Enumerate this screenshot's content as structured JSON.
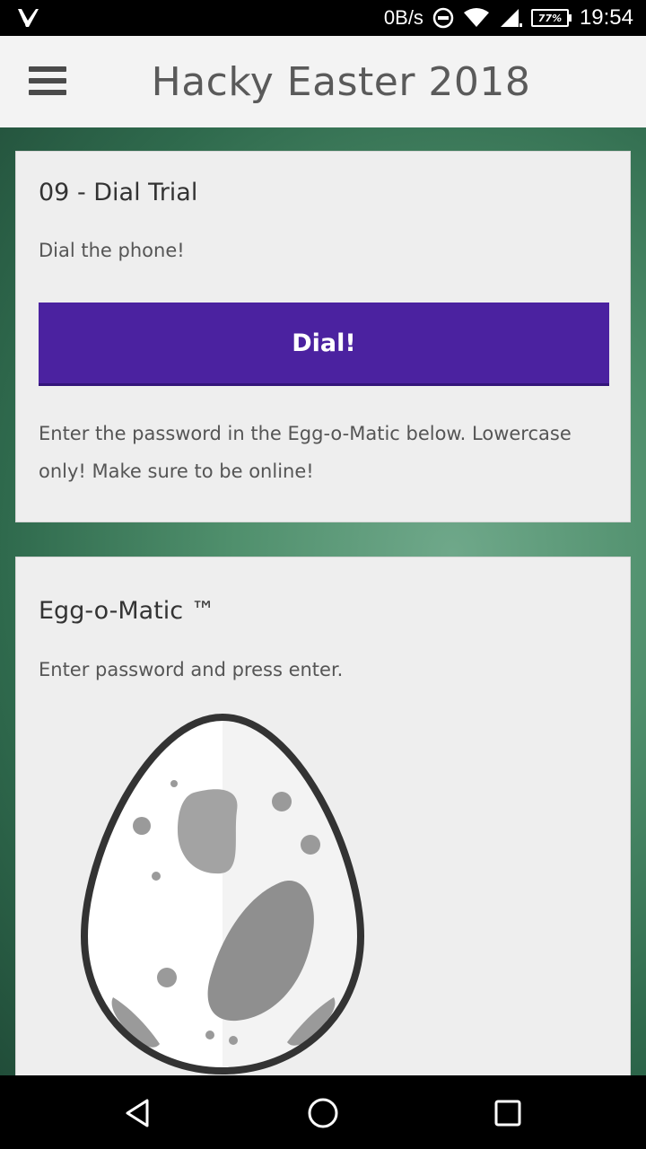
{
  "status_bar": {
    "speed": "0B/s",
    "battery": "77%",
    "time": "19:54",
    "icons": [
      "app-notification-icon",
      "dnd-icon",
      "wifi-icon",
      "signal-icon",
      "battery-icon"
    ]
  },
  "app_bar": {
    "title": "Hacky Easter 2018",
    "menu_icon": "hamburger-menu-icon"
  },
  "challenge_card": {
    "title": "09 - Dial Trial",
    "description": "Dial the phone!",
    "button_label": "Dial!",
    "instructions": "Enter the password in the Egg-o-Matic below. Lowercase only! Make sure to be online!"
  },
  "eggomatic_card": {
    "title": "Egg-o-Matic ™",
    "subtitle": "Enter password and press enter.",
    "image": "egg-icon"
  },
  "nav_bar": {
    "icons": [
      "back-icon",
      "home-icon",
      "recents-icon"
    ]
  },
  "colors": {
    "button": "#4b22a0",
    "background_green": "#4f8f6c",
    "card": "#eeeeee"
  }
}
